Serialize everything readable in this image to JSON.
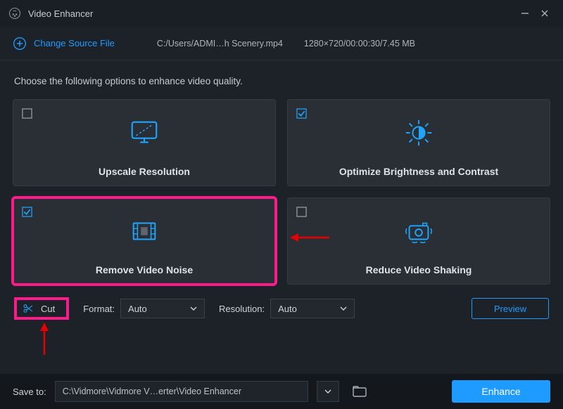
{
  "app": {
    "title": "Video Enhancer"
  },
  "header": {
    "change_label": "Change Source File",
    "file_path": "C:/Users/ADMI…h Scenery.mp4",
    "file_info": "1280×720/00:00:30/7.45 MB"
  },
  "instruction": "Choose the following options to enhance video quality.",
  "cards": {
    "upscale": {
      "label": "Upscale Resolution",
      "checked": false
    },
    "optimize": {
      "label": "Optimize Brightness and Contrast",
      "checked": true
    },
    "denoise": {
      "label": "Remove Video Noise",
      "checked": true
    },
    "deshake": {
      "label": "Reduce Video Shaking",
      "checked": false
    }
  },
  "opts": {
    "cut_label": "Cut",
    "format_label": "Format:",
    "format_value": "Auto",
    "resolution_label": "Resolution:",
    "resolution_value": "Auto",
    "preview_label": "Preview"
  },
  "footer": {
    "saveto_label": "Save to:",
    "saveto_path": "C:\\Vidmore\\Vidmore V…erter\\Video Enhancer",
    "enhance_label": "Enhance"
  }
}
